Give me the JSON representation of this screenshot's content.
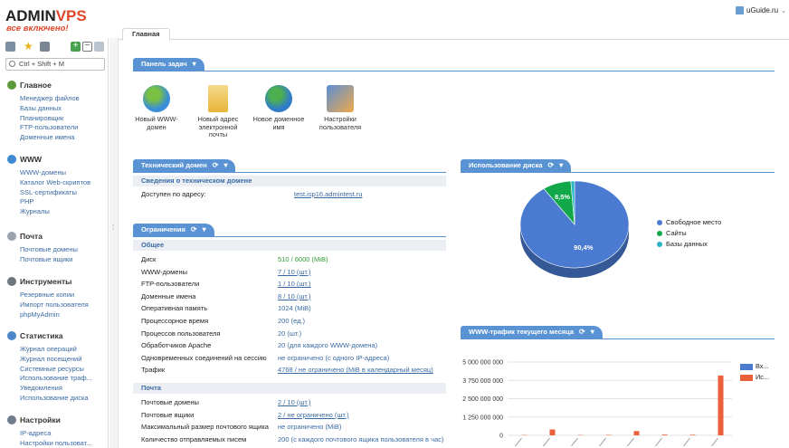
{
  "brand": {
    "logo_a": "ADMIN",
    "logo_b": "VPS",
    "slogan": "все включено!"
  },
  "user": {
    "name": "uGuide.ru"
  },
  "sidebar": {
    "search_placeholder": "Ctrl + Shift + M",
    "sections": [
      {
        "title": "Главное",
        "icon": "home-icon",
        "color": "#5d9a3a",
        "items": [
          "Менеджер файлов",
          "Базы данных",
          "Планировщик",
          "FTP-пользователи",
          "Доменные имена"
        ]
      },
      {
        "title": "WWW",
        "icon": "globe-icon",
        "color": "#3f8ad1",
        "items": [
          "WWW-домены",
          "Каталог Web-скриптов",
          "SSL-сертификаты",
          "PHP",
          "Журналы"
        ]
      },
      {
        "title": "Почта",
        "icon": "mail-icon",
        "color": "#9aa3ad",
        "items": [
          "Почтовые домены",
          "Почтовые ящики"
        ]
      },
      {
        "title": "Инструменты",
        "icon": "tools-icon",
        "color": "#6c7680",
        "items": [
          "Резервные копии",
          "Импорт пользователя",
          "phpMyAdmin"
        ]
      },
      {
        "title": "Статистика",
        "icon": "stats-icon",
        "color": "#4d86c8",
        "items": [
          "Журнал операций",
          "Журнал посещений",
          "Системные ресурсы",
          "Использование траф...",
          "Уведомления",
          "Использование диска"
        ]
      },
      {
        "title": "Настройки",
        "icon": "settings-icon",
        "color": "#6d7d8c",
        "items": [
          "IP-адреса",
          "Настройки пользоват..."
        ]
      }
    ]
  },
  "tabs": {
    "main": "Главная"
  },
  "taskpanel": {
    "title": "Панель задач",
    "tasks": [
      {
        "label": "Новый WWW-домен",
        "icon": "globe-plus-icon"
      },
      {
        "label": "Новый адрес электронной почты",
        "icon": "mail-plus-icon"
      },
      {
        "label": "Новое доменное имя",
        "icon": "domain-plus-icon"
      },
      {
        "label": "Настройки пользователя",
        "icon": "user-settings-icon"
      }
    ]
  },
  "techdomain": {
    "title": "Технический домен",
    "section": "Сведения о техническом домене",
    "key": "Доступен по адресу:",
    "value": "test.isp16.admintest.ru"
  },
  "limits": {
    "title": "Ограничения",
    "group_general": "Общее",
    "group_mail": "Почта",
    "general_rows": [
      {
        "k": "Диск",
        "v": "510 / 6000 (MiB)",
        "style": "green"
      },
      {
        "k": "WWW-домены",
        "v": "7 / 10 (шт.)",
        "style": "link"
      },
      {
        "k": "FTP-пользователи",
        "v": "1 / 10 (шт.)",
        "style": "link"
      },
      {
        "k": "Доменные имена",
        "v": "8 / 10 (шт.)",
        "style": "link"
      },
      {
        "k": "Оперативная память",
        "v": "1024 (MiB)",
        "style": "plain"
      },
      {
        "k": "Процессорное время",
        "v": "200 (ед.)",
        "style": "plain"
      },
      {
        "k": "Процессов пользователя",
        "v": "20 (шт.)",
        "style": "plain"
      },
      {
        "k": "Обработчиков Apache",
        "v": "20 (для каждого WWW-домена)",
        "style": "plain"
      },
      {
        "k": "Одновременных соединений на сессию",
        "v": "не ограничено (с одного IP-адреса)",
        "style": "plain"
      },
      {
        "k": "Трафик",
        "v": "4768 / не ограничено (MiB в календарный месяц)",
        "style": "link"
      }
    ],
    "mail_rows": [
      {
        "k": "Почтовые домены",
        "v": "2 / 10 (шт.)",
        "style": "link"
      },
      {
        "k": "Почтовые ящики",
        "v": "2 / не ограничено (шт.)",
        "style": "link"
      },
      {
        "k": "Максимальный размер почтового ящика",
        "v": "не ограничено (MiB)",
        "style": "plain"
      },
      {
        "k": "Количество отправляемых писем",
        "v": "200 (с каждого почтового ящика пользователя в час)",
        "style": "plain"
      }
    ]
  },
  "disk": {
    "title": "Использование диска",
    "legend": [
      {
        "label": "Свободное место",
        "color": "#4a7bd0"
      },
      {
        "label": "Сайты",
        "color": "#11a84a"
      },
      {
        "label": "Базы данных",
        "color": "#2bb6c7"
      }
    ],
    "labels": {
      "free": "90,4%",
      "sites": "8,5%"
    }
  },
  "traffic": {
    "title": "WWW-трафик текущего месяца",
    "legend": [
      {
        "label": "Вх...",
        "color": "#4a7bd0"
      },
      {
        "label": "Ис...",
        "color": "#e9603a"
      }
    ]
  },
  "chart_data": [
    {
      "type": "pie",
      "title": "Использование диска",
      "categories": [
        "Свободное место",
        "Сайты",
        "Базы данных"
      ],
      "values": [
        90.4,
        8.5,
        1.1
      ],
      "data_labels": [
        "90,4%",
        "8,5%",
        ""
      ],
      "colors": [
        "#4a7bd0",
        "#11a84a",
        "#2bb6c7"
      ],
      "legend": "right"
    },
    {
      "type": "bar",
      "title": "WWW-трафик текущего месяца",
      "yticks": [
        "5 000 000 000",
        "3 750 000 000",
        "2 500 000 000",
        "1 250 000 000",
        "0"
      ],
      "ylim": [
        0,
        5000000000
      ],
      "categories": [
        "c1",
        "c2",
        "c3",
        "c4",
        "c5",
        "c6",
        "c7",
        "c8"
      ],
      "series": [
        {
          "name": "Вх...",
          "color": "#4a7bd0",
          "values": [
            0,
            0,
            0,
            0,
            0,
            0,
            0,
            0
          ]
        },
        {
          "name": "Ис...",
          "color": "#e9603a",
          "values": [
            20000000,
            400000000,
            20000000,
            30000000,
            290000000,
            50000000,
            40000000,
            4080000000
          ]
        }
      ],
      "grid": true,
      "legend": "right"
    }
  ]
}
